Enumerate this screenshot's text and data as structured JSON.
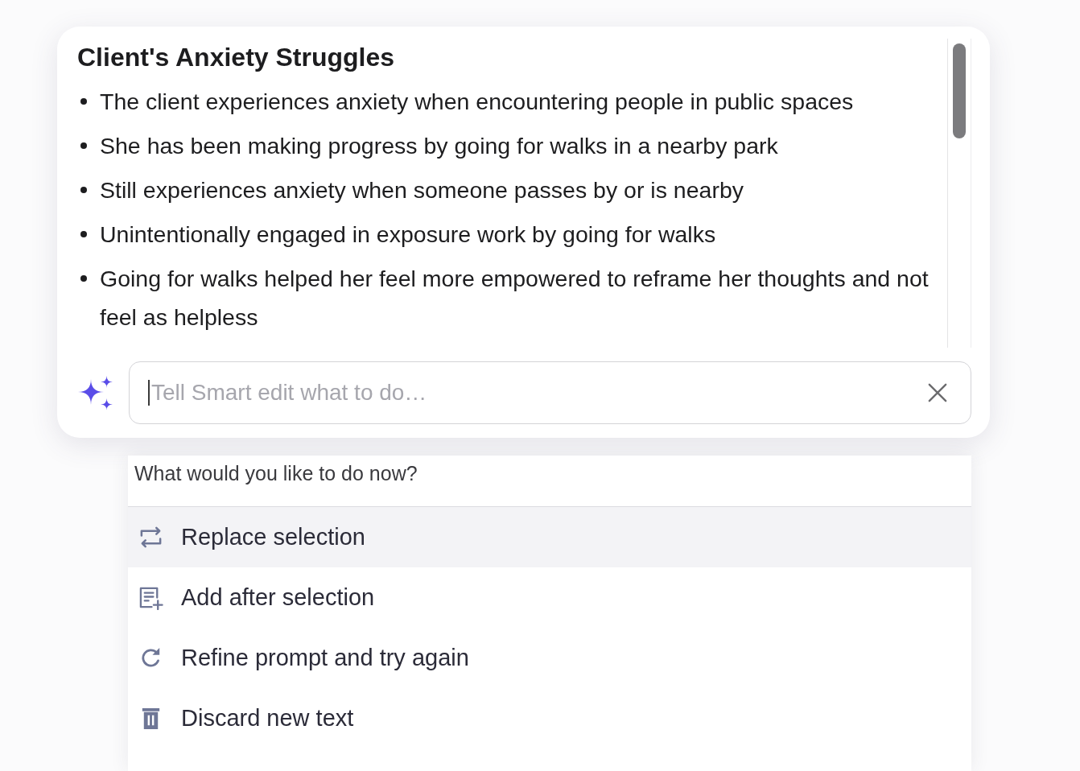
{
  "editor": {
    "title": "Client's Anxiety Struggles",
    "bullets": [
      "The client experiences anxiety when encountering people in public spaces",
      "She has been making progress by going for walks in a nearby park",
      "Still experiences anxiety when someone passes by or is nearby",
      "Unintentionally engaged in exposure work by going for walks",
      "Going for walks helped her feel more empowered to reframe her thoughts and not feel as helpless"
    ]
  },
  "smart_edit": {
    "placeholder": "Tell Smart edit what to do…",
    "focused": true
  },
  "menu": {
    "prompt": "What would you like to do now?",
    "items": [
      {
        "kind": "replace",
        "label": "Replace selection",
        "selected": true
      },
      {
        "kind": "add_after",
        "label": "Add after selection",
        "selected": false
      },
      {
        "kind": "refine",
        "label": "Refine prompt and try again",
        "selected": false
      },
      {
        "kind": "discard",
        "label": "Discard new text",
        "selected": false
      }
    ]
  }
}
